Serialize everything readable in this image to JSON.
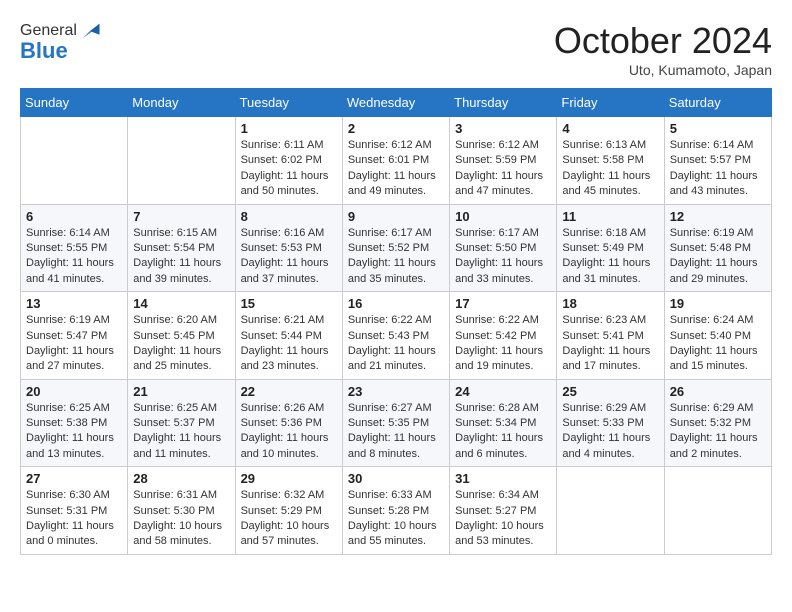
{
  "header": {
    "logo_line1": "General",
    "logo_line2": "Blue",
    "month_title": "October 2024",
    "location": "Uto, Kumamoto, Japan"
  },
  "weekdays": [
    "Sunday",
    "Monday",
    "Tuesday",
    "Wednesday",
    "Thursday",
    "Friday",
    "Saturday"
  ],
  "weeks": [
    [
      {
        "day": "",
        "info": ""
      },
      {
        "day": "",
        "info": ""
      },
      {
        "day": "1",
        "info": "Sunrise: 6:11 AM\nSunset: 6:02 PM\nDaylight: 11 hours and 50 minutes."
      },
      {
        "day": "2",
        "info": "Sunrise: 6:12 AM\nSunset: 6:01 PM\nDaylight: 11 hours and 49 minutes."
      },
      {
        "day": "3",
        "info": "Sunrise: 6:12 AM\nSunset: 5:59 PM\nDaylight: 11 hours and 47 minutes."
      },
      {
        "day": "4",
        "info": "Sunrise: 6:13 AM\nSunset: 5:58 PM\nDaylight: 11 hours and 45 minutes."
      },
      {
        "day": "5",
        "info": "Sunrise: 6:14 AM\nSunset: 5:57 PM\nDaylight: 11 hours and 43 minutes."
      }
    ],
    [
      {
        "day": "6",
        "info": "Sunrise: 6:14 AM\nSunset: 5:55 PM\nDaylight: 11 hours and 41 minutes."
      },
      {
        "day": "7",
        "info": "Sunrise: 6:15 AM\nSunset: 5:54 PM\nDaylight: 11 hours and 39 minutes."
      },
      {
        "day": "8",
        "info": "Sunrise: 6:16 AM\nSunset: 5:53 PM\nDaylight: 11 hours and 37 minutes."
      },
      {
        "day": "9",
        "info": "Sunrise: 6:17 AM\nSunset: 5:52 PM\nDaylight: 11 hours and 35 minutes."
      },
      {
        "day": "10",
        "info": "Sunrise: 6:17 AM\nSunset: 5:50 PM\nDaylight: 11 hours and 33 minutes."
      },
      {
        "day": "11",
        "info": "Sunrise: 6:18 AM\nSunset: 5:49 PM\nDaylight: 11 hours and 31 minutes."
      },
      {
        "day": "12",
        "info": "Sunrise: 6:19 AM\nSunset: 5:48 PM\nDaylight: 11 hours and 29 minutes."
      }
    ],
    [
      {
        "day": "13",
        "info": "Sunrise: 6:19 AM\nSunset: 5:47 PM\nDaylight: 11 hours and 27 minutes."
      },
      {
        "day": "14",
        "info": "Sunrise: 6:20 AM\nSunset: 5:45 PM\nDaylight: 11 hours and 25 minutes."
      },
      {
        "day": "15",
        "info": "Sunrise: 6:21 AM\nSunset: 5:44 PM\nDaylight: 11 hours and 23 minutes."
      },
      {
        "day": "16",
        "info": "Sunrise: 6:22 AM\nSunset: 5:43 PM\nDaylight: 11 hours and 21 minutes."
      },
      {
        "day": "17",
        "info": "Sunrise: 6:22 AM\nSunset: 5:42 PM\nDaylight: 11 hours and 19 minutes."
      },
      {
        "day": "18",
        "info": "Sunrise: 6:23 AM\nSunset: 5:41 PM\nDaylight: 11 hours and 17 minutes."
      },
      {
        "day": "19",
        "info": "Sunrise: 6:24 AM\nSunset: 5:40 PM\nDaylight: 11 hours and 15 minutes."
      }
    ],
    [
      {
        "day": "20",
        "info": "Sunrise: 6:25 AM\nSunset: 5:38 PM\nDaylight: 11 hours and 13 minutes."
      },
      {
        "day": "21",
        "info": "Sunrise: 6:25 AM\nSunset: 5:37 PM\nDaylight: 11 hours and 11 minutes."
      },
      {
        "day": "22",
        "info": "Sunrise: 6:26 AM\nSunset: 5:36 PM\nDaylight: 11 hours and 10 minutes."
      },
      {
        "day": "23",
        "info": "Sunrise: 6:27 AM\nSunset: 5:35 PM\nDaylight: 11 hours and 8 minutes."
      },
      {
        "day": "24",
        "info": "Sunrise: 6:28 AM\nSunset: 5:34 PM\nDaylight: 11 hours and 6 minutes."
      },
      {
        "day": "25",
        "info": "Sunrise: 6:29 AM\nSunset: 5:33 PM\nDaylight: 11 hours and 4 minutes."
      },
      {
        "day": "26",
        "info": "Sunrise: 6:29 AM\nSunset: 5:32 PM\nDaylight: 11 hours and 2 minutes."
      }
    ],
    [
      {
        "day": "27",
        "info": "Sunrise: 6:30 AM\nSunset: 5:31 PM\nDaylight: 11 hours and 0 minutes."
      },
      {
        "day": "28",
        "info": "Sunrise: 6:31 AM\nSunset: 5:30 PM\nDaylight: 10 hours and 58 minutes."
      },
      {
        "day": "29",
        "info": "Sunrise: 6:32 AM\nSunset: 5:29 PM\nDaylight: 10 hours and 57 minutes."
      },
      {
        "day": "30",
        "info": "Sunrise: 6:33 AM\nSunset: 5:28 PM\nDaylight: 10 hours and 55 minutes."
      },
      {
        "day": "31",
        "info": "Sunrise: 6:34 AM\nSunset: 5:27 PM\nDaylight: 10 hours and 53 minutes."
      },
      {
        "day": "",
        "info": ""
      },
      {
        "day": "",
        "info": ""
      }
    ]
  ]
}
